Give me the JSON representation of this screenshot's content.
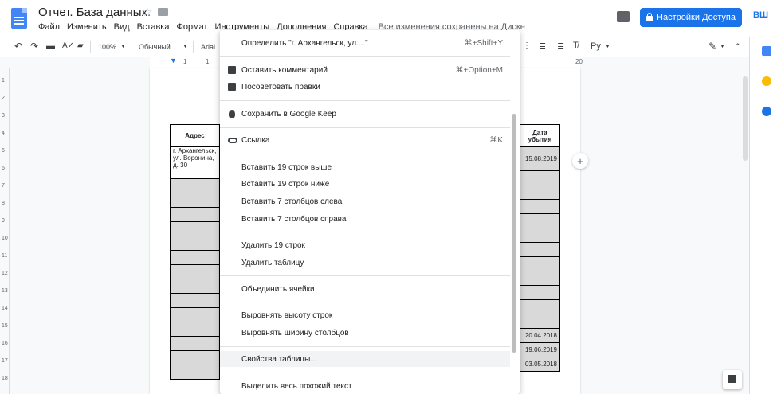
{
  "header": {
    "title": "Отчет. База данных.",
    "menu": [
      "Файл",
      "Изменить",
      "Вид",
      "Вставка",
      "Формат",
      "Инструменты",
      "Дополнения",
      "Справка"
    ],
    "save_status": "Все изменения сохранены на Диске",
    "share_label": "Настройки Доступа",
    "avatar_initials": "ВШ"
  },
  "toolbar": {
    "zoom": "100%",
    "style": "Обычный ...",
    "font": "Arial",
    "language": "Ру"
  },
  "ruler": {
    "left_marks": [
      "1",
      "1"
    ],
    "right_mark": "20"
  },
  "vruler_numbers": [
    "1",
    "2",
    "3",
    "4",
    "5",
    "6",
    "7",
    "8",
    "9",
    "10",
    "11",
    "12",
    "13",
    "14",
    "15",
    "16",
    "17",
    "18",
    "19"
  ],
  "table": {
    "header_left": "Адрес",
    "header_right": "Дата убытия",
    "first_address": "г. Архангельск, ул. Воронина, д. 30",
    "dates": [
      "15.08.2019",
      "",
      "",
      "",
      "",
      "",
      "",
      "",
      "",
      "",
      "",
      "",
      "20.04.2018",
      "19.06.2019",
      "03.05.2018"
    ]
  },
  "context_menu": {
    "items": [
      {
        "label": "Определить \"г. Архангельск, ул....\"",
        "shortcut": "⌘+Shift+Y",
        "icon": ""
      },
      {
        "label": "Оставить комментарий",
        "shortcut": "⌘+Option+M",
        "icon": "comment-add-icon"
      },
      {
        "label": "Посоветовать правки",
        "shortcut": "",
        "icon": "suggest-edit-icon"
      },
      {
        "label": "Сохранить в Google Keep",
        "shortcut": "",
        "icon": "keep-bulb-icon"
      },
      {
        "label": "Ссылка",
        "shortcut": "⌘K",
        "icon": "link-icon"
      },
      {
        "label": "Вставить 19 строк выше",
        "shortcut": "",
        "icon": ""
      },
      {
        "label": "Вставить 19 строк ниже",
        "shortcut": "",
        "icon": ""
      },
      {
        "label": "Вставить 7 столбцов слева",
        "shortcut": "",
        "icon": ""
      },
      {
        "label": "Вставить 7 столбцов справа",
        "shortcut": "",
        "icon": ""
      },
      {
        "label": "Удалить 19 строк",
        "shortcut": "",
        "icon": ""
      },
      {
        "label": "Удалить таблицу",
        "shortcut": "",
        "icon": ""
      },
      {
        "label": "Объединить ячейки",
        "shortcut": "",
        "icon": ""
      },
      {
        "label": "Выровнять высоту строк",
        "shortcut": "",
        "icon": ""
      },
      {
        "label": "Выровнять ширину столбцов",
        "shortcut": "",
        "icon": ""
      },
      {
        "label": "Свойства таблицы...",
        "shortcut": "",
        "icon": ""
      },
      {
        "label": "Выделить весь похожий текст",
        "shortcut": "",
        "icon": ""
      }
    ]
  },
  "colors": {
    "accent": "#1a73e8",
    "highlight": "#f1f3f4",
    "cell_gray": "#d9d9d9"
  }
}
